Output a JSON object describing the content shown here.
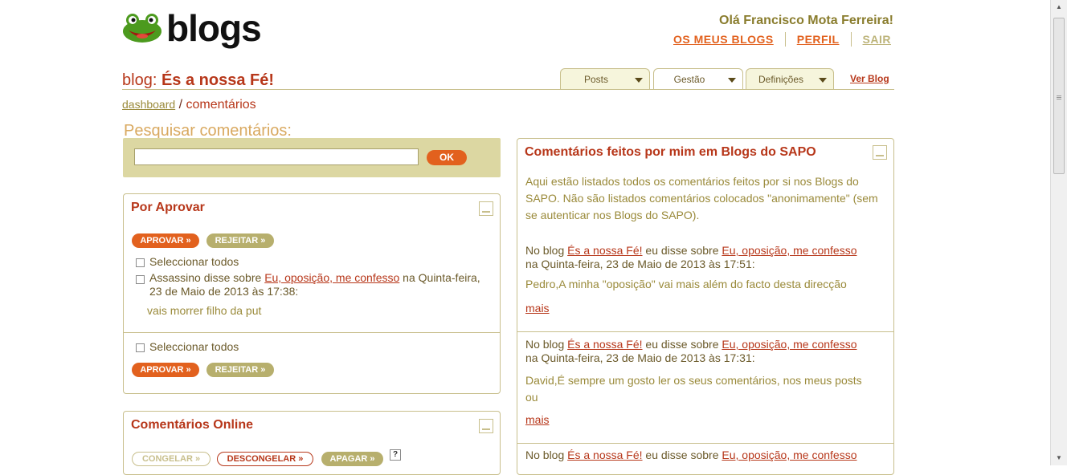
{
  "header": {
    "logo_text": "blogs",
    "greeting": "Olá Francisco Mota Ferreira!",
    "nav": [
      "OS MEUS BLOGS",
      "PERFIL",
      "SAIR"
    ]
  },
  "blog": {
    "prefix": "blog: ",
    "name": "És a nossa Fé!"
  },
  "tabs": [
    "Posts",
    "Gestão",
    "Definições"
  ],
  "ver_blog": "Ver Blog",
  "breadcrumb": {
    "link": "dashboard",
    "sep": " / ",
    "current": "comentários"
  },
  "search": {
    "label": "Pesquisar comentários:",
    "button": "OK",
    "value": ""
  },
  "por_aprovar": {
    "title": "Por Aprovar",
    "approve": "APROVAR »",
    "reject": "REJEITAR »",
    "select_all": "Seleccionar todos",
    "comment": {
      "author_text": "Assassino disse sobre ",
      "post_link": "Eu, oposição, me confesso",
      "date_text": " na Quinta-feira,",
      "date_text2": "23 de Maio de 2013 às 17:38:",
      "body": "vais morrer filho da put"
    }
  },
  "online": {
    "title": "Comentários Online",
    "freeze": "CONGELAR »",
    "unfreeze": "DESCONGELAR »",
    "delete": "APAGAR »",
    "help": "?"
  },
  "my_comments": {
    "title": "Comentários feitos por mim em Blogs do SAPO",
    "intro_lines": [
      "Aqui estão listados todos os comentários feitos por si nos Blogs do",
      "SAPO. Não são listados comentários colocados \"anonimamente\" (sem",
      "se autenticar nos Blogs do SAPO)."
    ],
    "entry_prefix": "No blog ",
    "entry_mid": " eu disse sobre ",
    "more": "mais",
    "entries": [
      {
        "blog": "És a nossa Fé!",
        "post": "Eu, oposição, me confesso",
        "date": "na Quinta-feira, 23 de Maio de 2013 às 17:51:",
        "body": [
          "Pedro,A minha \"oposição\" vai mais além do facto desta direcção"
        ]
      },
      {
        "blog": "És a nossa Fé!",
        "post": "Eu, oposição, me confesso",
        "date": "na Quinta-feira, 23 de Maio de 2013 às 17:31:",
        "body": [
          "David,É sempre um gosto ler os seus comentários, nos meus posts",
          "ou"
        ]
      },
      {
        "blog": "És a nossa Fé!",
        "post": "Eu, oposição, me confesso",
        "date": "",
        "body": []
      }
    ]
  },
  "colors": {
    "accent": "#b7371a",
    "orange": "#e2611e",
    "olive": "#b7af6d",
    "panel_bg": "#dcd7a2"
  }
}
